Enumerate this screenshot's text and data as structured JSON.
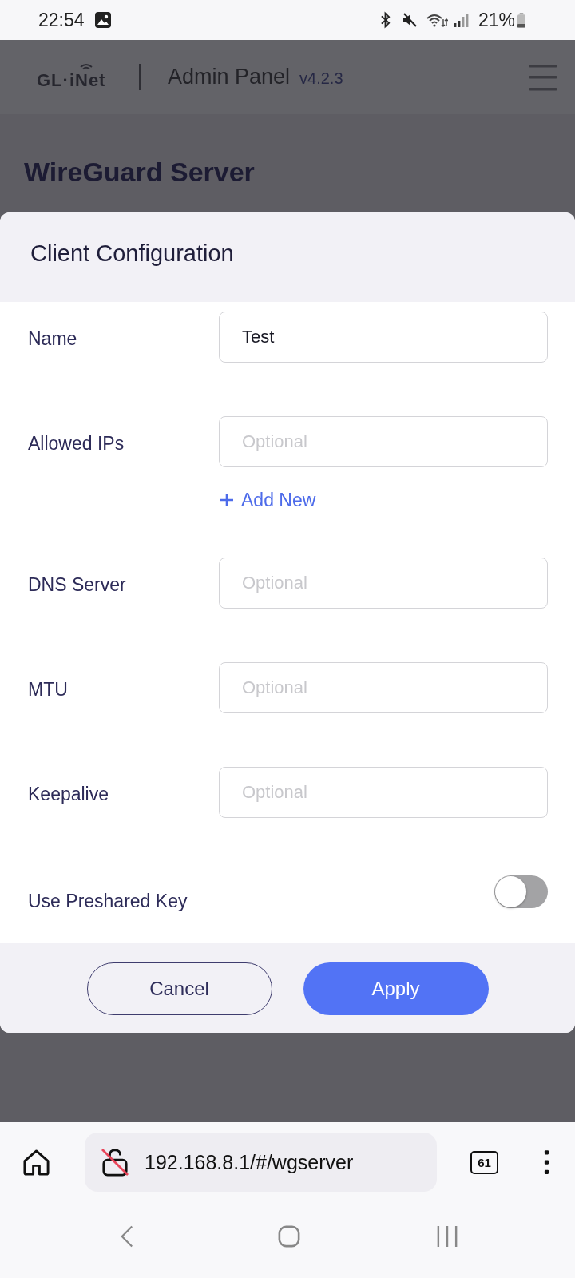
{
  "status_bar": {
    "time": "22:54",
    "battery": "21%"
  },
  "header": {
    "logo": "GL·iNet",
    "title": "Admin Panel",
    "version": "v4.2.3"
  },
  "page": {
    "title": "WireGuard Server"
  },
  "dialog": {
    "title": "Client Configuration",
    "fields": [
      {
        "kind": "input",
        "label": "Name",
        "value": "Test"
      },
      {
        "kind": "input",
        "label": "Allowed IPs",
        "placeholder": "Optional",
        "add_link": "Add New"
      },
      {
        "kind": "input",
        "label": "DNS Server",
        "placeholder": "Optional"
      },
      {
        "kind": "input",
        "label": "MTU",
        "placeholder": "Optional"
      },
      {
        "kind": "input",
        "label": "Keepalive",
        "placeholder": "Optional"
      },
      {
        "kind": "toggle",
        "label": "Use Preshared Key",
        "on": false
      }
    ],
    "buttons": [
      {
        "kind": "secondary",
        "label": "Cancel"
      },
      {
        "kind": "primary",
        "label": "Apply"
      }
    ]
  },
  "browser": {
    "url": "192.168.8.1/#/wgserver",
    "tab_count": "61"
  }
}
